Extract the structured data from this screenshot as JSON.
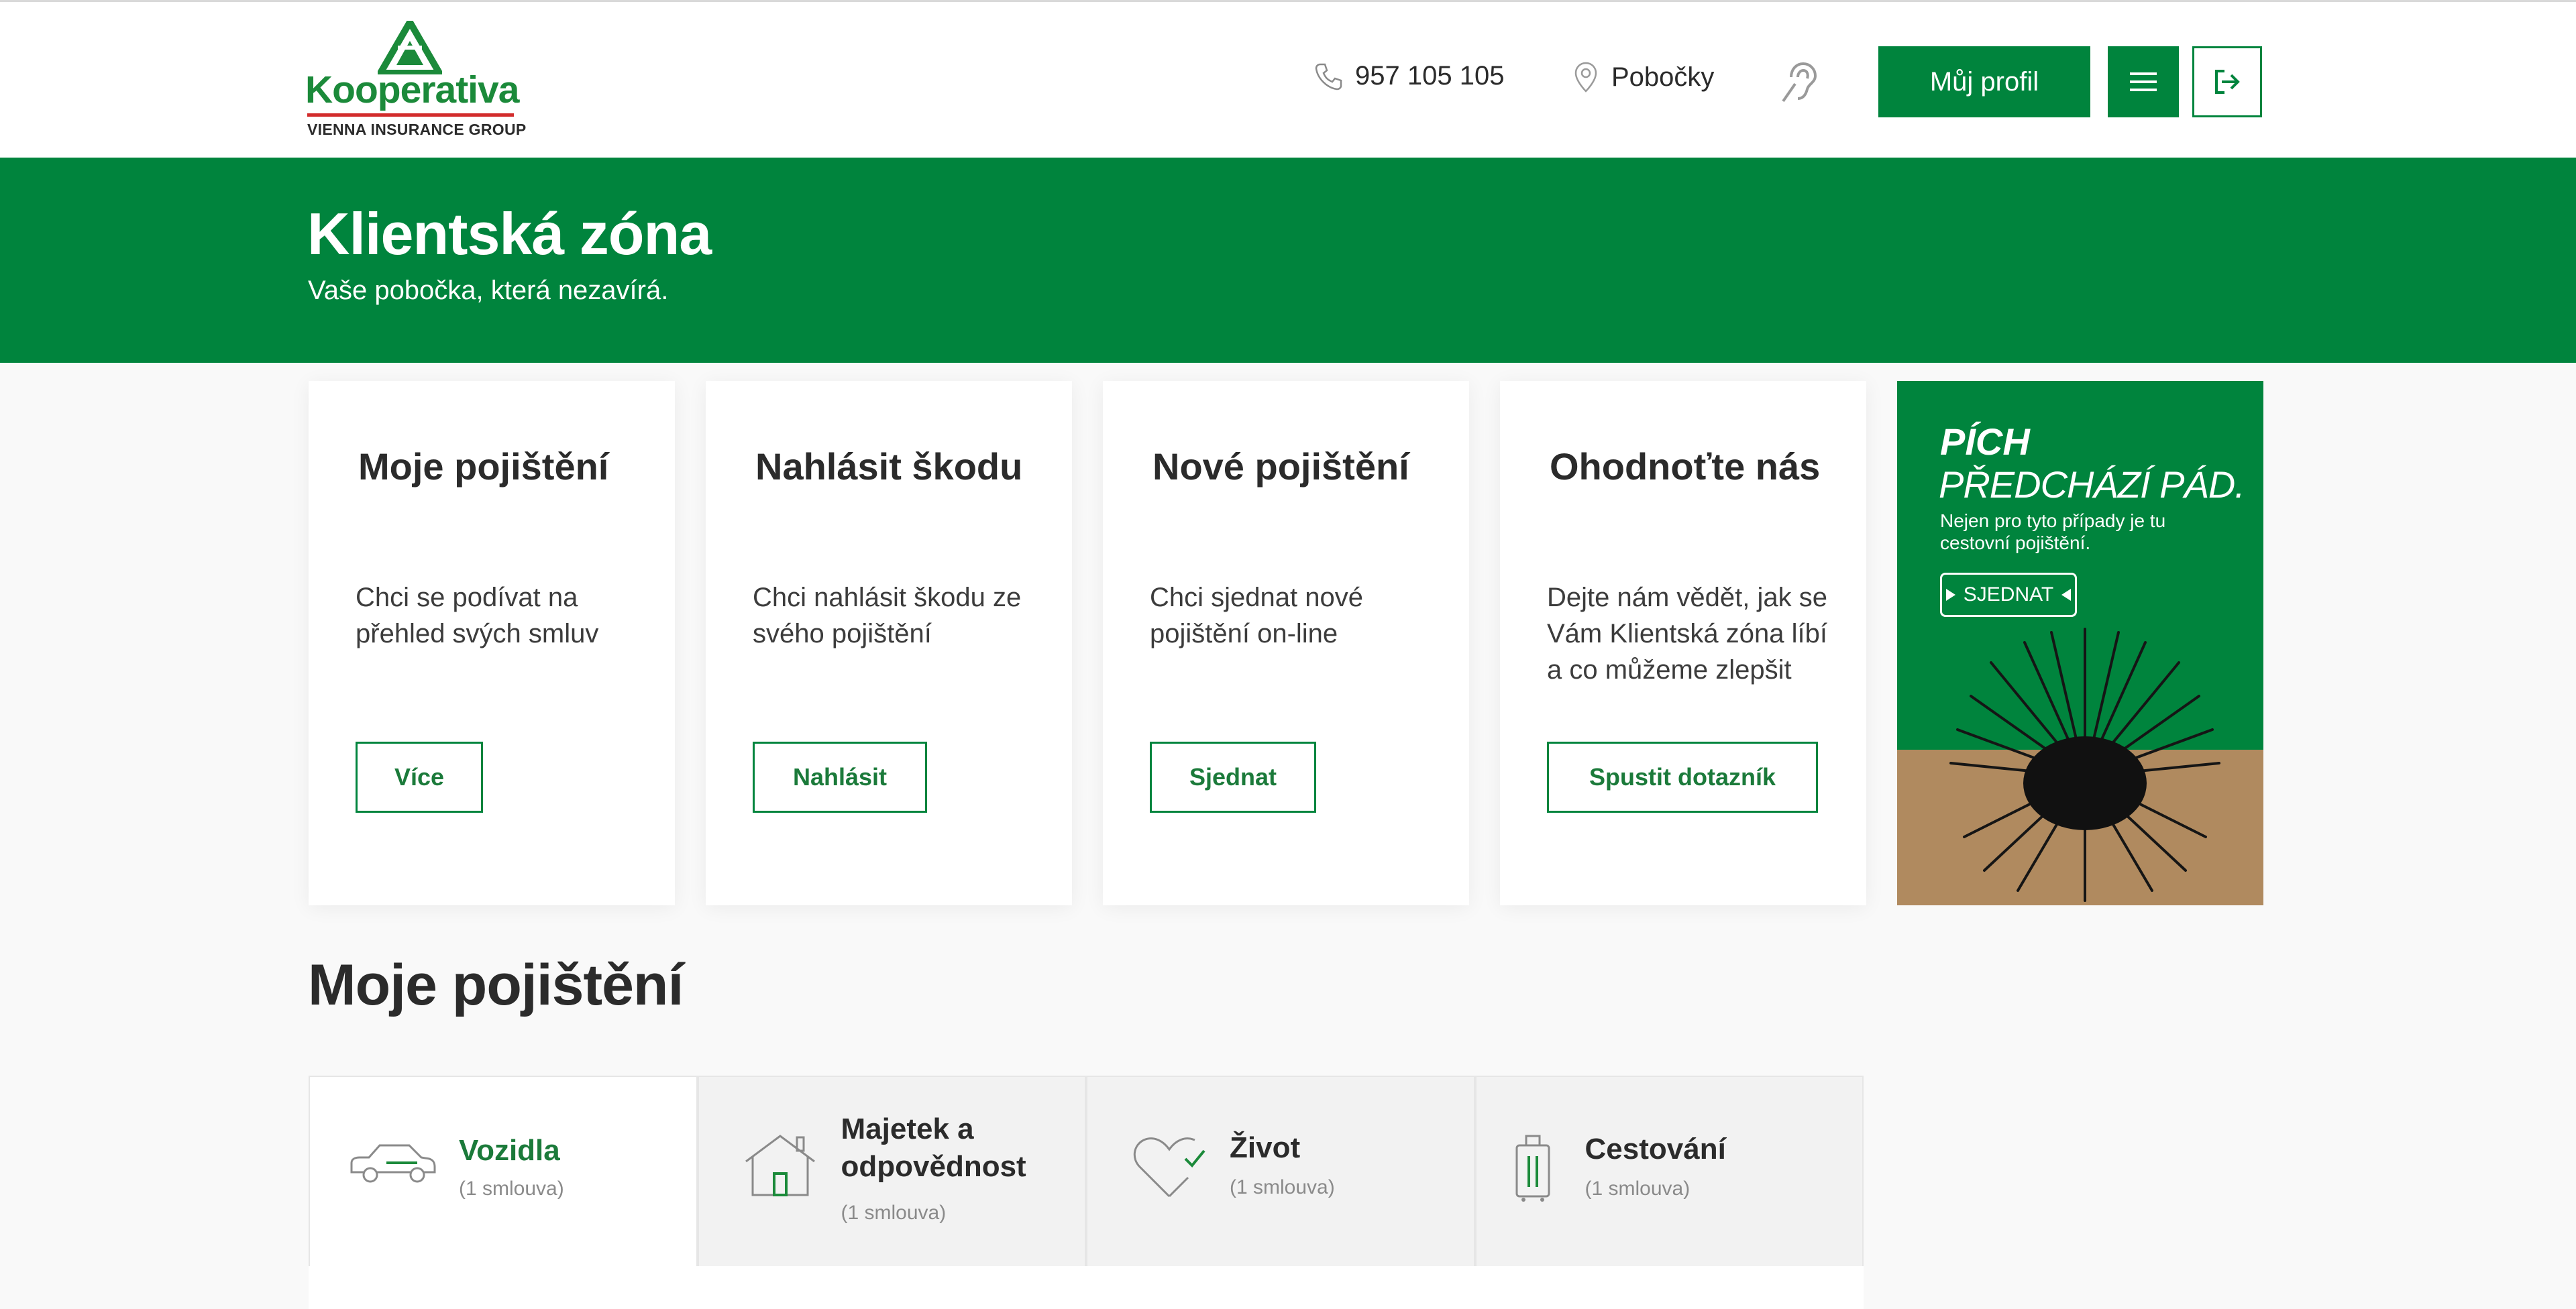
{
  "header": {
    "logo": {
      "name": "Kooperativa",
      "subtitle": "VIENNA INSURANCE GROUP"
    },
    "phone": "957 105 105",
    "branches": "Pobočky",
    "profile_button": "Můj profil",
    "icons": [
      "phone-icon",
      "location-pin-icon",
      "hearing-icon",
      "menu-icon",
      "logout-icon"
    ]
  },
  "hero": {
    "title": "Klientská zóna",
    "subtitle": "Vaše pobočka, která nezavírá."
  },
  "cards": [
    {
      "title": "Moje pojištění",
      "text": "Chci se podívat na přehled svých smluv",
      "button": "Více"
    },
    {
      "title": "Nahlásit škodu",
      "text": "Chci nahlásit škodu ze svého pojištění",
      "button": "Nahlásit"
    },
    {
      "title": "Nové pojištění",
      "text": "Chci sjednat nové pojištění on-line",
      "button": "Sjednat"
    },
    {
      "title": "Ohodnoťte nás",
      "text": "Dejte nám vědět, jak se Vám Klientská zóna líbí a co můžeme zlepšit",
      "button": "Spustit dotazník"
    }
  ],
  "promo": {
    "title_line1": "PÍCH",
    "title_line2": "PŘEDCHÁZÍ PÁD.",
    "text": "Nejen pro tyto případy je tu cestovní pojištění.",
    "cta": "SJEDNAT"
  },
  "section": {
    "title": "Moje pojištění",
    "tabs": [
      {
        "label": "Vozidla",
        "count": "(1 smlouva)",
        "active": true,
        "icon": "car-icon"
      },
      {
        "label": "Majetek a odpovědnost",
        "count": "(1 smlouva)",
        "active": false,
        "icon": "house-icon"
      },
      {
        "label": "Život",
        "count": "(1 smlouva)",
        "active": false,
        "icon": "heart-icon"
      },
      {
        "label": "Cestování",
        "count": "(1 smlouva)",
        "active": false,
        "icon": "luggage-icon"
      }
    ]
  },
  "colors": {
    "brand_green": "#00843d",
    "logo_red": "#d22b2b",
    "sand": "#b08a5f"
  }
}
